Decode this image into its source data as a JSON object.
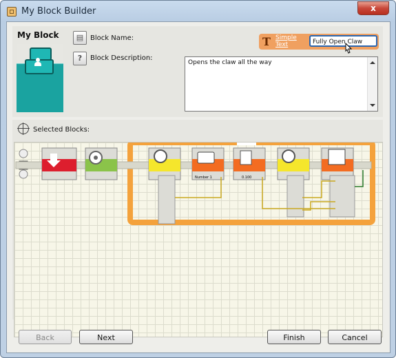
{
  "window": {
    "title": "My Block Builder",
    "close_glyph": "x"
  },
  "header": {
    "section_title": "My Block",
    "block_name_label": "Block Name:",
    "block_description_label": "Block Description:"
  },
  "block_name": {
    "value": "Fully Open Claw"
  },
  "simple_text": {
    "glyph": "T",
    "label": "Simple Text"
  },
  "block_description": {
    "value": "Opens the claw all the way"
  },
  "selected_blocks": {
    "label": "Selected Blocks:"
  },
  "blocks": {
    "math_label": "Number 1",
    "constant_value": "0.100"
  },
  "footer": {
    "back_label": "Back",
    "next_label": "Next",
    "finish_label": "Finish",
    "cancel_label": "Cancel"
  },
  "colors": {
    "accent_orange": "#f0a060",
    "block_teal": "#1aa3a0",
    "loop_orange": "#f4a23c"
  }
}
